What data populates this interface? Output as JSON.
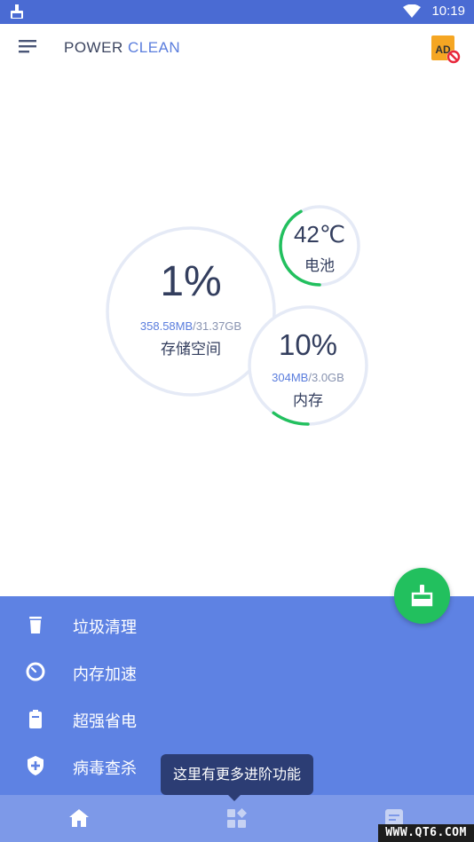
{
  "status_bar": {
    "time": "10:19",
    "icons": [
      "cleaner-notification-icon",
      "wifi-icon",
      "battery-icon"
    ]
  },
  "app_bar": {
    "title_part1": "POWER",
    "title_part2": "CLEAN",
    "menu_icon": "hamburger-menu-icon",
    "ad_icon": "ad-block-icon",
    "ad_text": "AD"
  },
  "storage": {
    "percent": "1%",
    "used": "358.58MB",
    "total": "/31.37GB",
    "label": "存储空间",
    "progress": 0.01
  },
  "battery": {
    "temperature": "42℃",
    "label": "电池",
    "progress": 0.42
  },
  "memory": {
    "percent": "10%",
    "used": "304MB",
    "total": "/3.0GB",
    "label": "内存",
    "progress": 0.1
  },
  "panel": {
    "items": [
      {
        "label": "垃圾清理",
        "icon": "trash-icon"
      },
      {
        "label": "内存加速",
        "icon": "speedometer-icon"
      },
      {
        "label": "超强省电",
        "icon": "battery-saver-icon"
      },
      {
        "label": "病毒查杀",
        "icon": "shield-plus-icon"
      }
    ],
    "fab_icon": "broom-clean-icon"
  },
  "tooltip": {
    "text": "这里有更多进阶功能"
  },
  "bottom_nav": {
    "items": [
      {
        "icon": "home-icon"
      },
      {
        "icon": "grid-apps-icon"
      },
      {
        "icon": "note-icon"
      }
    ]
  },
  "watermark": "WWW.QT6.COM",
  "colors": {
    "primary": "#4a6bd3",
    "panel": "#5e82e3",
    "accent_green": "#22c05e",
    "ring_gray": "#e5eaf6",
    "tooltip_bg": "#2c3d74"
  }
}
